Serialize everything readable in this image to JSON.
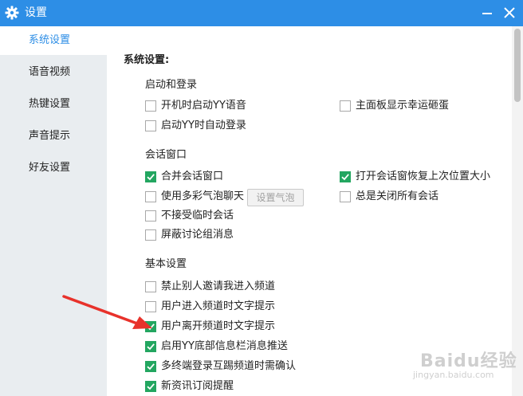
{
  "window": {
    "title": "设置"
  },
  "sidebar": {
    "items": [
      {
        "label": "系统设置",
        "active": true
      },
      {
        "label": "语音视频",
        "active": false
      },
      {
        "label": "热键设置",
        "active": false
      },
      {
        "label": "声音提示",
        "active": false
      },
      {
        "label": "好友设置",
        "active": false
      }
    ]
  },
  "content": {
    "section_title": "系统设置:",
    "groups": [
      {
        "title": "启动和登录",
        "options": [
          {
            "label": "开机时启动YY语音",
            "checked": false
          },
          {
            "label": "主面板显示幸运砸蛋",
            "checked": false
          },
          {
            "label": "启动YY时自动登录",
            "checked": false
          }
        ]
      },
      {
        "title": "会话窗口",
        "options": [
          {
            "label": "合并会话窗口",
            "checked": true
          },
          {
            "label": "打开会话窗恢复上次位置大小",
            "checked": true
          },
          {
            "label": "使用多彩气泡聊天",
            "checked": false
          },
          {
            "label": "总是关闭所有会话",
            "checked": false
          },
          {
            "label": "不接受临时会话",
            "checked": false
          },
          {
            "label": "屏蔽讨论组消息",
            "checked": false
          }
        ],
        "bubble_button": "设置气泡"
      },
      {
        "title": "基本设置",
        "options": [
          {
            "label": "禁止别人邀请我进入频道",
            "checked": false
          },
          {
            "label": "用户进入频道时文字提示",
            "checked": false
          },
          {
            "label": "用户离开频道时文字提示",
            "checked": true
          },
          {
            "label": "启用YY底部信息栏消息推送",
            "checked": true
          },
          {
            "label": "多终端登录互踢频道时需确认",
            "checked": true
          },
          {
            "label": "新资讯订阅提醒",
            "checked": true
          }
        ]
      }
    ]
  },
  "watermark": {
    "text": "Baidu经验",
    "sub": "jingyan.baidu.com"
  },
  "colors": {
    "accent": "#2d8ee6",
    "check": "#23a660",
    "arrow": "#e8322b"
  }
}
